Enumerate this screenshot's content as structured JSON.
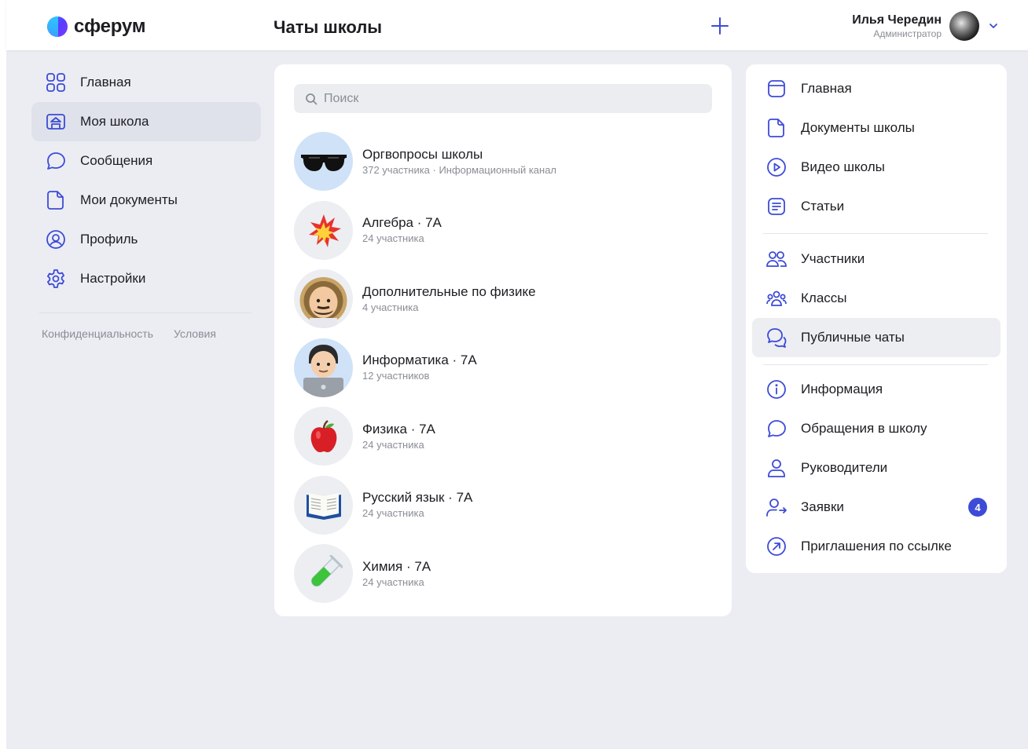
{
  "brand": {
    "name": "сферум"
  },
  "header": {
    "title": "Чаты школы",
    "user_name": "Илья Чередин",
    "user_role": "Администратор"
  },
  "colors": {
    "accent": "#3d4bd6",
    "background": "#ebedf3",
    "active_item": "#dfe2ea"
  },
  "left_nav": {
    "items": [
      {
        "label": "Главная",
        "icon": "grid-icon"
      },
      {
        "label": "Моя школа",
        "icon": "school-icon",
        "active": true
      },
      {
        "label": "Сообщения",
        "icon": "message-icon"
      },
      {
        "label": "Мои документы",
        "icon": "document-icon"
      },
      {
        "label": "Профиль",
        "icon": "profile-icon"
      },
      {
        "label": "Настройки",
        "icon": "gear-icon"
      }
    ],
    "footer": {
      "privacy": "Конфиденциальность",
      "terms": "Условия"
    }
  },
  "search": {
    "placeholder": "Поиск"
  },
  "chats": [
    {
      "title": "Оргвопросы школы",
      "subtitle": "372 участника · Информационный канал",
      "avatar": "sunglasses-emoji"
    },
    {
      "title": "Алгебра · 7А",
      "subtitle": "24 участника",
      "avatar": "explosion-emoji"
    },
    {
      "title": "Дополнительные по физике",
      "subtitle": "4 участника",
      "avatar": "astronaut-emoji"
    },
    {
      "title": "Информатика · 7А",
      "subtitle": "12 участников",
      "avatar": "technologist-emoji"
    },
    {
      "title": "Физика · 7А",
      "subtitle": "24 участника",
      "avatar": "apple-emoji"
    },
    {
      "title": "Русский язык · 7А",
      "subtitle": "24 участника",
      "avatar": "book-emoji"
    },
    {
      "title": "Химия · 7А",
      "subtitle": "24 участника",
      "avatar": "test-tube-emoji"
    }
  ],
  "right_menu": {
    "group1": [
      {
        "label": "Главная",
        "icon": "square-icon"
      },
      {
        "label": "Документы школы",
        "icon": "document-icon"
      },
      {
        "label": "Видео школы",
        "icon": "play-icon"
      },
      {
        "label": "Статьи",
        "icon": "article-icon"
      }
    ],
    "group2": [
      {
        "label": "Участники",
        "icon": "users-icon"
      },
      {
        "label": "Классы",
        "icon": "classes-icon"
      },
      {
        "label": "Публичные чаты",
        "icon": "chats-icon",
        "active": true
      }
    ],
    "group3": [
      {
        "label": "Информация",
        "icon": "info-icon"
      },
      {
        "label": "Обращения в школу",
        "icon": "message-icon"
      },
      {
        "label": "Руководители",
        "icon": "person-icon"
      },
      {
        "label": "Заявки",
        "icon": "person-arrow-icon",
        "badge": "4"
      },
      {
        "label": "Приглашения по ссылке",
        "icon": "link-arrow-icon"
      }
    ]
  }
}
